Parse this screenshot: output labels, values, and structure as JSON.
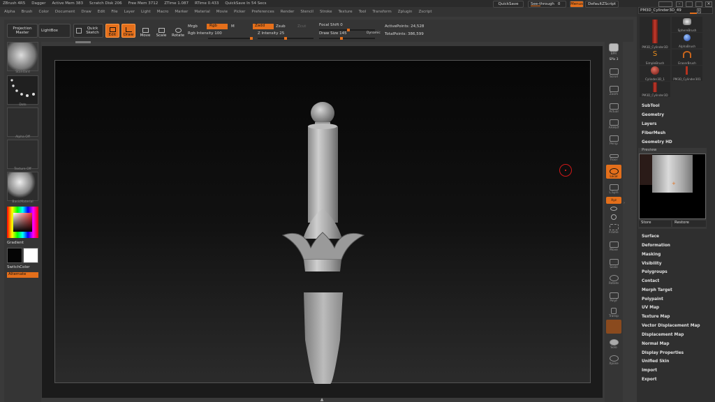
{
  "titlebar": {
    "app": "ZBrush 4R5",
    "doc": "Dagger",
    "stats": [
      "Active Mem 383",
      "Scratch Disk 206",
      "Free Mem 3712",
      "ZTime 1.087",
      "RTime 0.433",
      "QuickSave In 54 Secs"
    ]
  },
  "menus": [
    "Alpha",
    "Brush",
    "Color",
    "Document",
    "Draw",
    "Edit",
    "File",
    "Layer",
    "Light",
    "Macro",
    "Marker",
    "Material",
    "Movie",
    "Picker",
    "Preferences",
    "Render",
    "Stencil",
    "Stroke",
    "Texture",
    "Tool",
    "Transform",
    "Zplugin",
    "Zscript"
  ],
  "topright": {
    "quicksave": "QuickSave",
    "seethrough_label": "See-through",
    "seethrough_value": "0",
    "menus": "Menus",
    "script": "DefaultZScript",
    "tool_name": "PM3D_Cylinder3D_49"
  },
  "toolbar": {
    "projection": "Projection Master",
    "lightbox": "LightBox",
    "quick_sketch": "Quick Sketch",
    "edit": "Edit",
    "draw": "Draw",
    "move": "Move",
    "scale": "Scale",
    "rotate": "Rotate",
    "mrgb": "Mrgb",
    "rgb": "Rgb",
    "m": "M",
    "zadd": "Zadd",
    "zsub": "Zsub",
    "zcut": "Zcut",
    "rgb_intensity": "Rgb Intensity 100",
    "z_intensity": "Z Intensity 25",
    "focal_shift": "Focal Shift 0",
    "draw_size": "Draw Size 145",
    "dynamic": "Dynamic",
    "active_points": "ActivePoints: 24,528",
    "total_points": "TotalPoints: 386,599"
  },
  "left": {
    "brush": "Standard",
    "stroke": "Dots",
    "alpha": "Alpha Off",
    "texture": "Texture Off",
    "material": "BasicMaterial",
    "gradient": "Gradient",
    "switchcolor": "SwitchColor",
    "alternate": "Alternate"
  },
  "rightbar": [
    "BPR",
    "SPix 3",
    "Scroll",
    "Zoom",
    "Actual",
    "AAHalf",
    "Persp",
    "Floor",
    "Local",
    "L.Sym",
    "Xyz",
    "Frame",
    "Move",
    "Scale",
    "Rotate",
    "PolyF",
    "Transp",
    "Solo",
    "Xpose"
  ],
  "tray": {
    "tool_thumbs": [
      "PM3D_Cylinder3D",
      "SphereBrush",
      "AlphaBrush",
      "SimpleBrush",
      "EraserBrush",
      "Cylinder3D_1",
      "PM3D_Cylinder301",
      "PM3D_Cylinder3D"
    ],
    "upper_items": [
      "SubTool",
      "Geometry",
      "Layers",
      "FiberMesh",
      "Geometry HD"
    ],
    "preview": "Preview",
    "store": "Store",
    "restore": "Restore",
    "lower_items": [
      "Surface",
      "Deformation",
      "Masking",
      "Visibility",
      "Polygroups",
      "Contact",
      "Morph Target",
      "Polypaint",
      "UV Map",
      "Texture Map",
      "Vector Displacement Map",
      "Displacement Map",
      "Normal Map",
      "Display Properties",
      "Unified Skin",
      "Import",
      "Export"
    ]
  },
  "colors": {
    "accent": "#e46f1b",
    "background": "#3a3a3a"
  }
}
